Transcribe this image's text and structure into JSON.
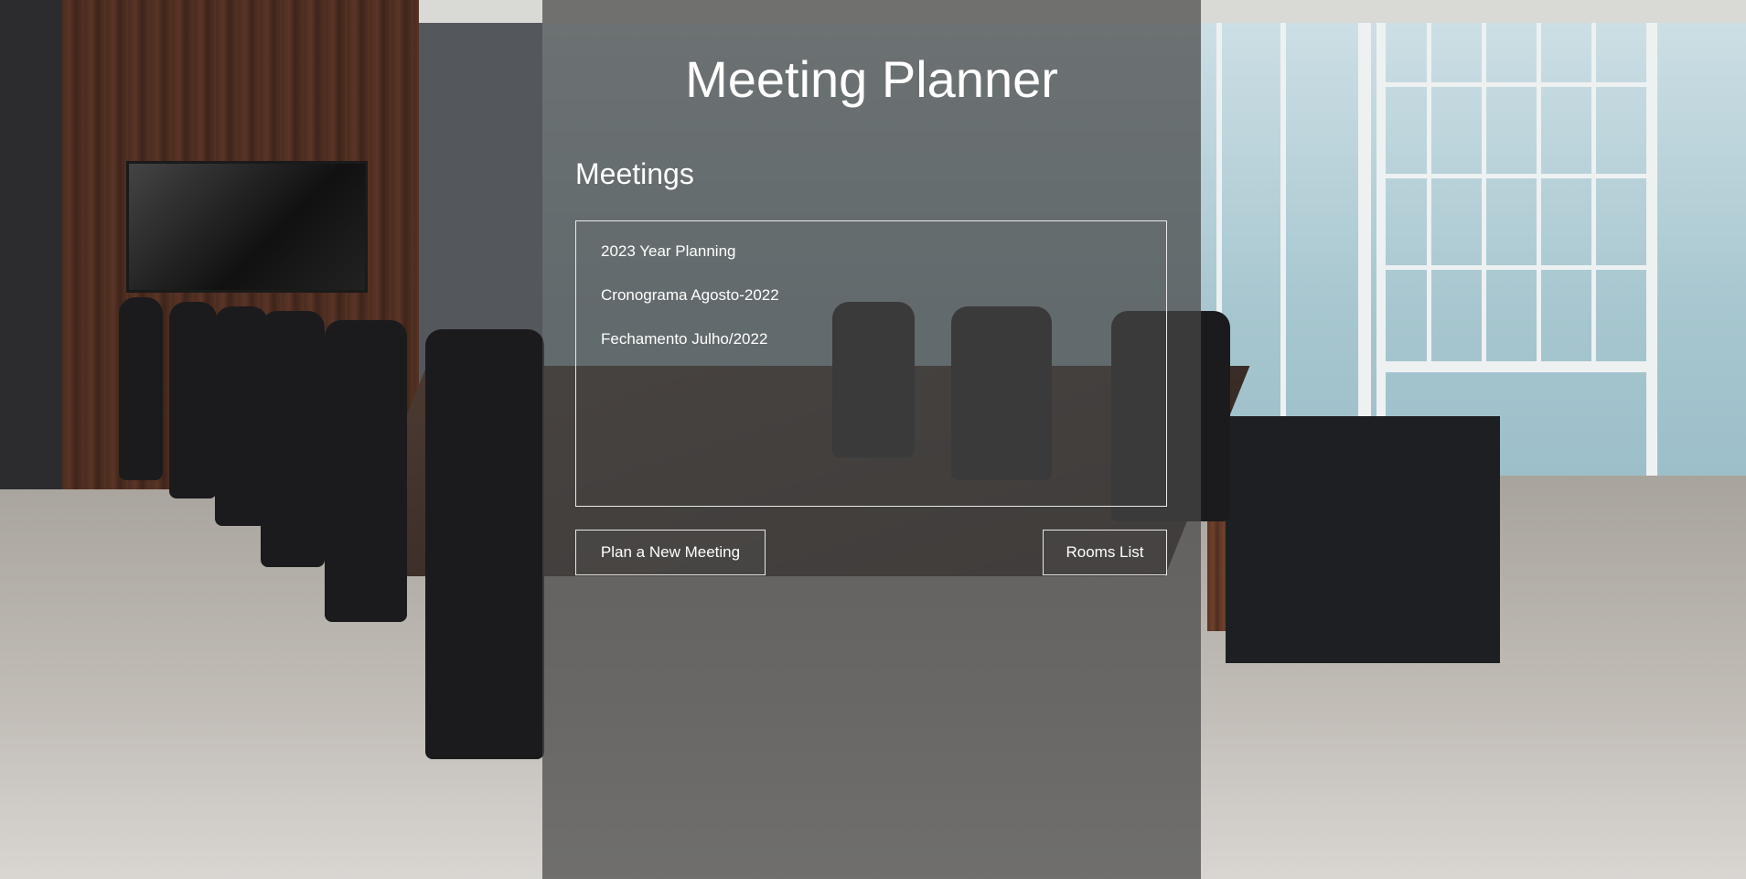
{
  "header": {
    "title": "Meeting Planner"
  },
  "meetings": {
    "heading": "Meetings",
    "items": [
      {
        "label": "2023 Year Planning"
      },
      {
        "label": "Cronograma Agosto-2022"
      },
      {
        "label": "Fechamento Julho/2022"
      }
    ]
  },
  "actions": {
    "new_meeting_label": "Plan a New Meeting",
    "rooms_list_label": "Rooms List"
  },
  "colors": {
    "overlay": "#464646",
    "text": "#ffffff",
    "border": "#e8e8e8"
  },
  "background": {
    "image_subject": "conference-room-photo"
  }
}
